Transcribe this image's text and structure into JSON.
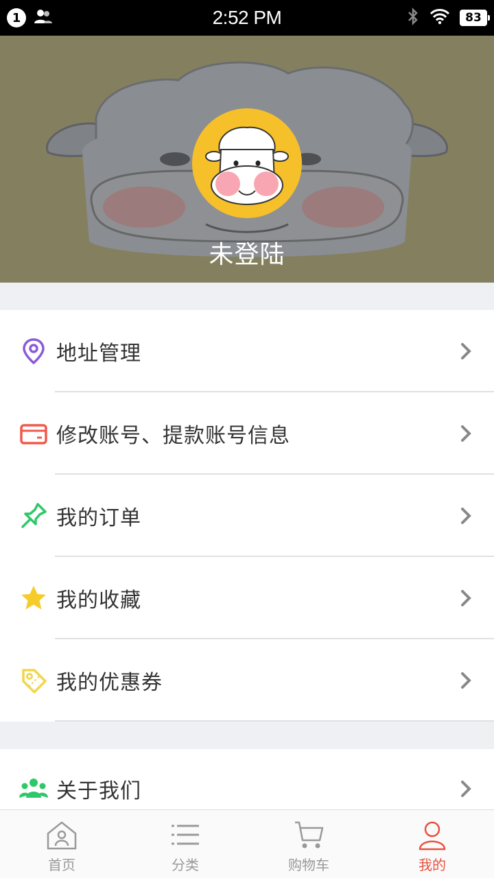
{
  "status_bar": {
    "notification_count": "1",
    "time": "2:52 PM",
    "battery": "83"
  },
  "profile": {
    "login_status": "未登陆"
  },
  "menu": {
    "group_1": [
      {
        "label": "地址管理",
        "icon": "location-pin-icon",
        "color": "#8a5ad8"
      },
      {
        "label": "修改账号、提款账号信息",
        "icon": "credit-card-icon",
        "color": "#ef5a4c"
      },
      {
        "label": "我的订单",
        "icon": "pin-icon",
        "color": "#2ec86a"
      },
      {
        "label": "我的收藏",
        "icon": "star-icon",
        "color": "#f5cc2a"
      },
      {
        "label": "我的优惠券",
        "icon": "coupon-tag-icon",
        "color": "#f2d64a"
      }
    ],
    "group_2": [
      {
        "label": "关于我们",
        "icon": "group-users-icon",
        "color": "#2ec86a"
      }
    ]
  },
  "tab_bar": {
    "tabs": [
      {
        "label": "首页",
        "icon": "home-icon",
        "active": false
      },
      {
        "label": "分类",
        "icon": "list-icon",
        "active": false
      },
      {
        "label": "购物车",
        "icon": "cart-icon",
        "active": false
      },
      {
        "label": "我的",
        "icon": "user-icon",
        "active": true
      }
    ],
    "active_color": "#e8523f",
    "inactive_color": "#999999"
  },
  "colors": {
    "header_bg": "#84805f",
    "avatar_bg": "#f6c02a",
    "page_bg": "#eef0f3"
  }
}
